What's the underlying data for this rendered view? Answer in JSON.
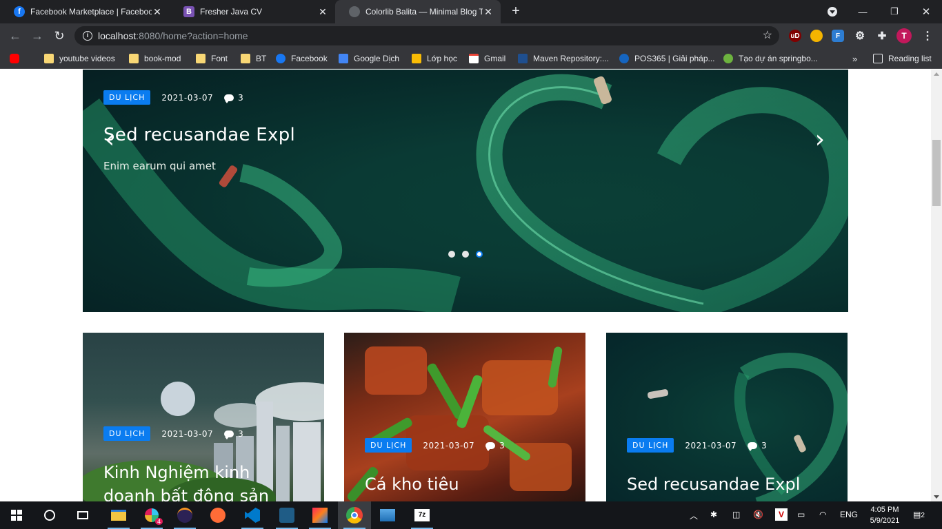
{
  "browser": {
    "tabs": [
      {
        "title": "Facebook Marketplace | Facebook",
        "icon": "facebook-icon",
        "active": false
      },
      {
        "title": "Fresher Java CV",
        "icon": "bootstrap-icon",
        "active": false
      },
      {
        "title": "Colorlib Balita — Minimal Blog Template",
        "icon": "globe-icon",
        "active": true
      }
    ],
    "new_tab": "+",
    "address": {
      "host": "localhost",
      "rest": ":8080/home?action=home"
    },
    "profile_initial": "T",
    "bookmarks": [
      {
        "label": "",
        "icon": "youtube-icon"
      },
      {
        "label": "youtube videos",
        "icon": "folder-icon"
      },
      {
        "label": "book-mod",
        "icon": "folder-icon"
      },
      {
        "label": "Font",
        "icon": "folder-icon"
      },
      {
        "label": "BT",
        "icon": "folder-icon"
      },
      {
        "label": "Facebook",
        "icon": "facebook-icon"
      },
      {
        "label": "Google Dịch",
        "icon": "google-translate-icon"
      },
      {
        "label": "Lớp học",
        "icon": "classroom-icon"
      },
      {
        "label": "Gmail",
        "icon": "gmail-icon"
      },
      {
        "label": "Maven Repository:...",
        "icon": "maven-icon"
      },
      {
        "label": "POS365 | Giải pháp...",
        "icon": "pos365-icon"
      },
      {
        "label": "Tạo dự án springbo...",
        "icon": "spring-icon"
      }
    ],
    "more_bookmarks": "»",
    "reading_list": "Reading list"
  },
  "hero": {
    "category": "DU LỊCH",
    "date": "2021-03-07",
    "comments": "3",
    "title": "Sed recusandae Expl",
    "subtitle": "Enim earum qui amet",
    "prev": "‹",
    "next": "›",
    "active_slide": 3,
    "slides": 3
  },
  "cards": [
    {
      "category": "DU LỊCH",
      "date": "2021-03-07",
      "comments": "3",
      "title_line1": "Kinh Nghiệm kinh",
      "title_line2": "doanh bất động sản"
    },
    {
      "category": "DU LỊCH",
      "date": "2021-03-07",
      "comments": "3",
      "title_line1": "Cá kho tiêu",
      "title_line2": ""
    },
    {
      "category": "DU LỊCH",
      "date": "2021-03-07",
      "comments": "3",
      "title_line1": "Sed recusandae Expl",
      "title_line2": ""
    }
  ],
  "taskbar": {
    "language": "ENG",
    "time": "4:05 PM",
    "date": "5/9/2021",
    "notifications": "2",
    "slack_badge": "4"
  },
  "colors": {
    "accent": "#0a7cf0",
    "chrome_dark": "#202124",
    "chrome_toolbar": "#35363a",
    "taskbar": "#14161a"
  }
}
